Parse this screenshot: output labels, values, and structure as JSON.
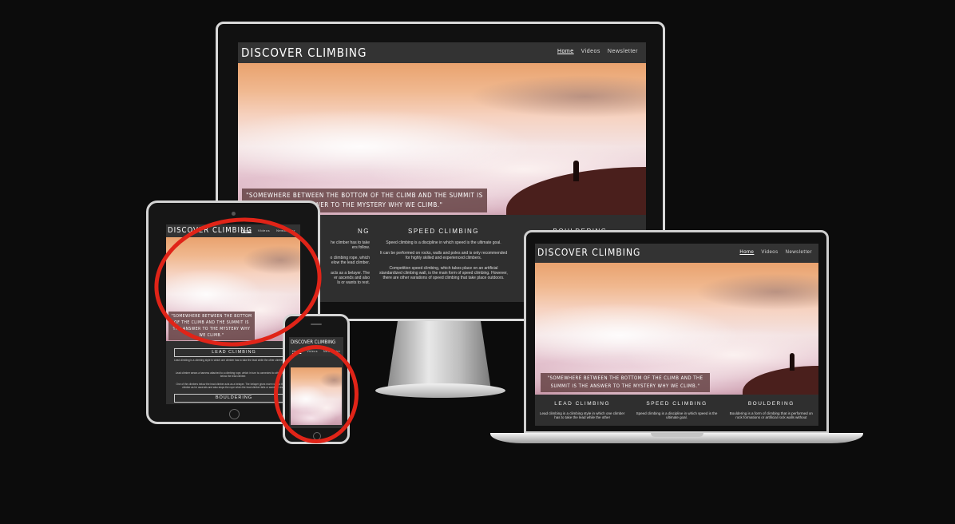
{
  "site": {
    "brand": "DISCOVER CLIMBING",
    "nav": [
      "Home",
      "Videos",
      "Newsletter"
    ],
    "quote": "\"SOMEWHERE BETWEEN THE BOTTOM OF THE CLIMB AND THE SUMMIT IS THE ANSWER TO THE MYSTERY WHY WE CLIMB.\"",
    "quote_tablet": "\"SOMEWHERE BETWEEN THE BOTTOM OF THE CLIMB AND THE SUMMIT IS THE ANSWER TO THE MYSTERY WHY WE CLIMB.\"",
    "sections": {
      "lead": {
        "title": "LEAD   CLIMBING",
        "title_desktop_fragment": "NG",
        "p1": "Lead climbing is a climbing style in which one climber has to take the lead while the other climbers follow.",
        "p1_desktop_fragment": "he climber has to take\ners follow.",
        "p2": "Lead climber wears a harness attached to a climbing rope, which in turn is connected to other climbers below the lead climber.",
        "p2_desktop_fragment": "o climbing rope, which\nelow the lead climber.",
        "p3": "One of the climbers below the lead climber acts as a belayer. The belayer gives more rope to the lead climber as he ascends and also stops the rope when the lead climber falls or wants to rest.",
        "p3_desktop_fragment": "acts as a belayer. The\ner ascends and also\nls or wants to rest.",
        "laptop_p": "Lead climbing is a climbing style in which one climber has to take the lead while the other"
      },
      "speed": {
        "title": "SPEED   CLIMBING",
        "p1": "Speed climbing is a discipline in which speed is the ultimate goal.",
        "p2": "It can be performed on rocks, walls and poles and is only recommended for highly skilled and experienced climbers.",
        "p3": "Competition speed climbing, which takes place on an artificial standardized climbing wall, is the main form of speed climbing. However, there are other variations of speed climbing that take place outdoors.",
        "laptop_p": "Speed climbing is a discipline in which speed is the ultimate goal."
      },
      "bouldering": {
        "title": "BOULDERING",
        "laptop_p": "Bouldering is a form of climbing that is performed on rock formations or artificial rock walls without"
      }
    }
  },
  "colors": {
    "background": "#0c0c0c",
    "header": "#333333",
    "content": "#2f2f2f",
    "quote_box": "#694648",
    "highlight_ring": "#e02418"
  }
}
